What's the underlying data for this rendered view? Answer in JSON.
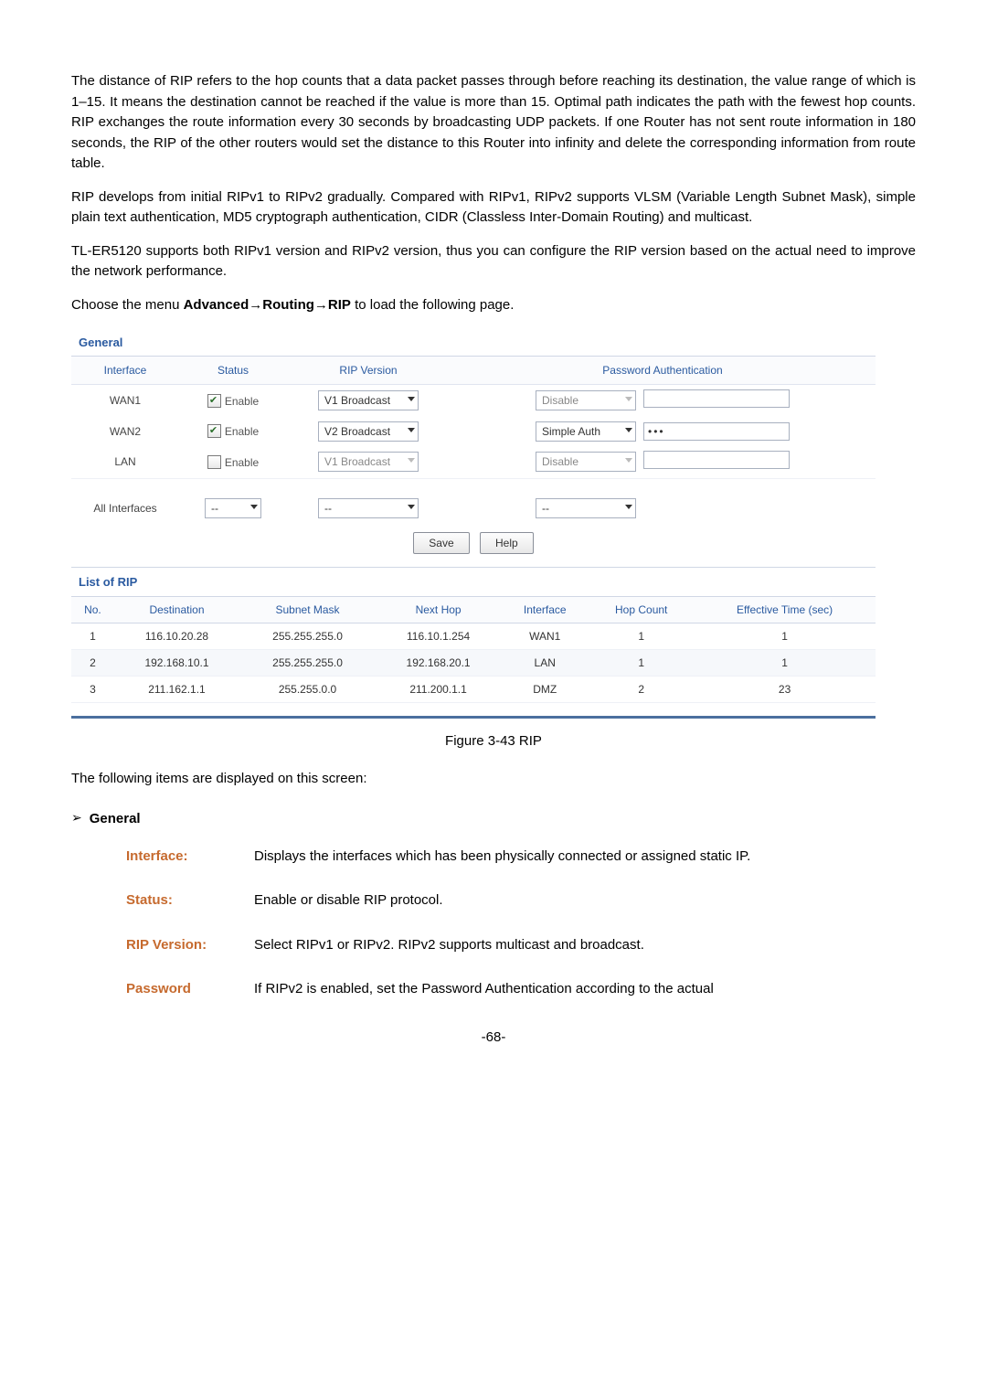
{
  "paragraphs": {
    "p1": "The distance of RIP refers to the hop counts that a data packet passes through before reaching its destination, the value range of which is 1–15. It means the destination cannot be reached if the value is more than 15. Optimal path indicates the path with the fewest hop counts. RIP exchanges the route information every 30 seconds by broadcasting UDP packets. If one Router has not sent route information in 180 seconds, the RIP of the other routers would set the distance to this Router into infinity and delete the corresponding information from route table.",
    "p2": "RIP develops from initial RIPv1 to RIPv2 gradually. Compared with RIPv1, RIPv2 supports VLSM (Variable Length Subnet Mask), simple plain text authentication, MD5 cryptograph authentication, CIDR (Classless Inter-Domain Routing) and multicast.",
    "p3": "TL-ER5120 supports both RIPv1 version and RIPv2 version, thus you can configure the RIP version based on the actual need to improve the network performance.",
    "p4_prefix": "Choose the menu ",
    "p4_bold": "Advanced→Routing→RIP",
    "p4_suffix": " to load the following page."
  },
  "ui": {
    "section_general": "General",
    "headers": {
      "interface": "Interface",
      "status": "Status",
      "rip_version": "RIP Version",
      "pwd_auth": "Password Authentication"
    },
    "rows": [
      {
        "iface": "WAN1",
        "enabled": true,
        "enable_label": "Enable",
        "rip_sel": "V1 Broadcast",
        "rip_disabled": false,
        "auth_sel": "Disable",
        "auth_disabled": true,
        "pwd": ""
      },
      {
        "iface": "WAN2",
        "enabled": true,
        "enable_label": "Enable",
        "rip_sel": "V2 Broadcast",
        "rip_disabled": false,
        "auth_sel": "Simple Auth",
        "auth_disabled": false,
        "pwd": "•••"
      },
      {
        "iface": "LAN",
        "enabled": false,
        "enable_label": "Enable",
        "rip_sel": "V1 Broadcast",
        "rip_disabled": true,
        "auth_sel": "Disable",
        "auth_disabled": true,
        "pwd": ""
      }
    ],
    "all_if_label": "All Interfaces",
    "all_status_sel": "--",
    "all_rip_sel": "--",
    "all_auth_sel": "--",
    "btn_save": "Save",
    "btn_help": "Help",
    "section_list": "List of RIP",
    "list_headers": {
      "no": "No.",
      "dest": "Destination",
      "mask": "Subnet Mask",
      "next": "Next Hop",
      "iface": "Interface",
      "hop": "Hop Count",
      "eff": "Effective Time (sec)"
    },
    "list_rows": [
      {
        "no": "1",
        "dest": "116.10.20.28",
        "mask": "255.255.255.0",
        "next": "116.10.1.254",
        "iface": "WAN1",
        "hop": "1",
        "eff": "1"
      },
      {
        "no": "2",
        "dest": "192.168.10.1",
        "mask": "255.255.255.0",
        "next": "192.168.20.1",
        "iface": "LAN",
        "hop": "1",
        "eff": "1"
      },
      {
        "no": "3",
        "dest": "211.162.1.1",
        "mask": "255.255.0.0",
        "next": "211.200.1.1",
        "iface": "DMZ",
        "hop": "2",
        "eff": "23"
      }
    ]
  },
  "figure_caption": "Figure 3-43 RIP",
  "following_items": "The following items are displayed on this screen:",
  "general_heading": "General",
  "defs": [
    {
      "term": "Interface:",
      "desc": "Displays the interfaces which has been physically connected or assigned static IP."
    },
    {
      "term": "Status:",
      "desc": "Enable or disable RIP protocol."
    },
    {
      "term": "RIP Version:",
      "desc": "Select RIPv1 or RIPv2. RIPv2 supports multicast and broadcast."
    },
    {
      "term": "Password",
      "desc": "If RIPv2 is enabled, set the Password Authentication according to the actual"
    }
  ],
  "page_number": "-68-"
}
